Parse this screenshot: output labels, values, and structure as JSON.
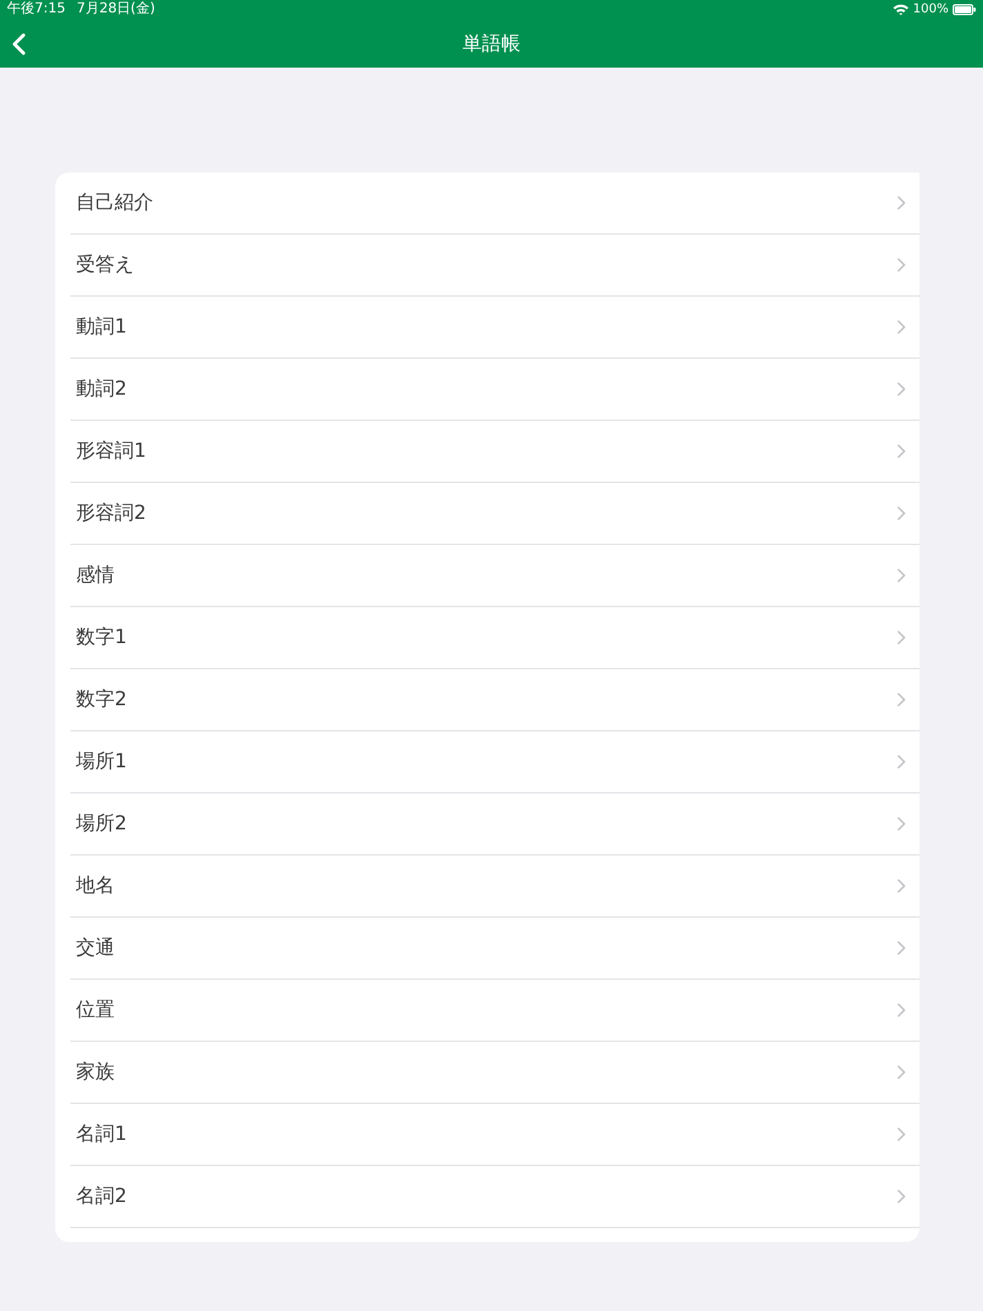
{
  "status_bar": {
    "time": "午後7:15",
    "date": "7月28日(金)",
    "battery": "100%"
  },
  "nav_bar": {
    "title": "単語帳"
  },
  "list": {
    "items": [
      {
        "label": "自己紹介"
      },
      {
        "label": "受答え"
      },
      {
        "label": "動詞1"
      },
      {
        "label": "動詞2"
      },
      {
        "label": "形容詞1"
      },
      {
        "label": "形容詞2"
      },
      {
        "label": "感情"
      },
      {
        "label": "数字1"
      },
      {
        "label": "数字2"
      },
      {
        "label": "場所1"
      },
      {
        "label": "場所2"
      },
      {
        "label": "地名"
      },
      {
        "label": "交通"
      },
      {
        "label": "位置"
      },
      {
        "label": "家族"
      },
      {
        "label": "名詞1"
      },
      {
        "label": "名詞2"
      }
    ]
  }
}
